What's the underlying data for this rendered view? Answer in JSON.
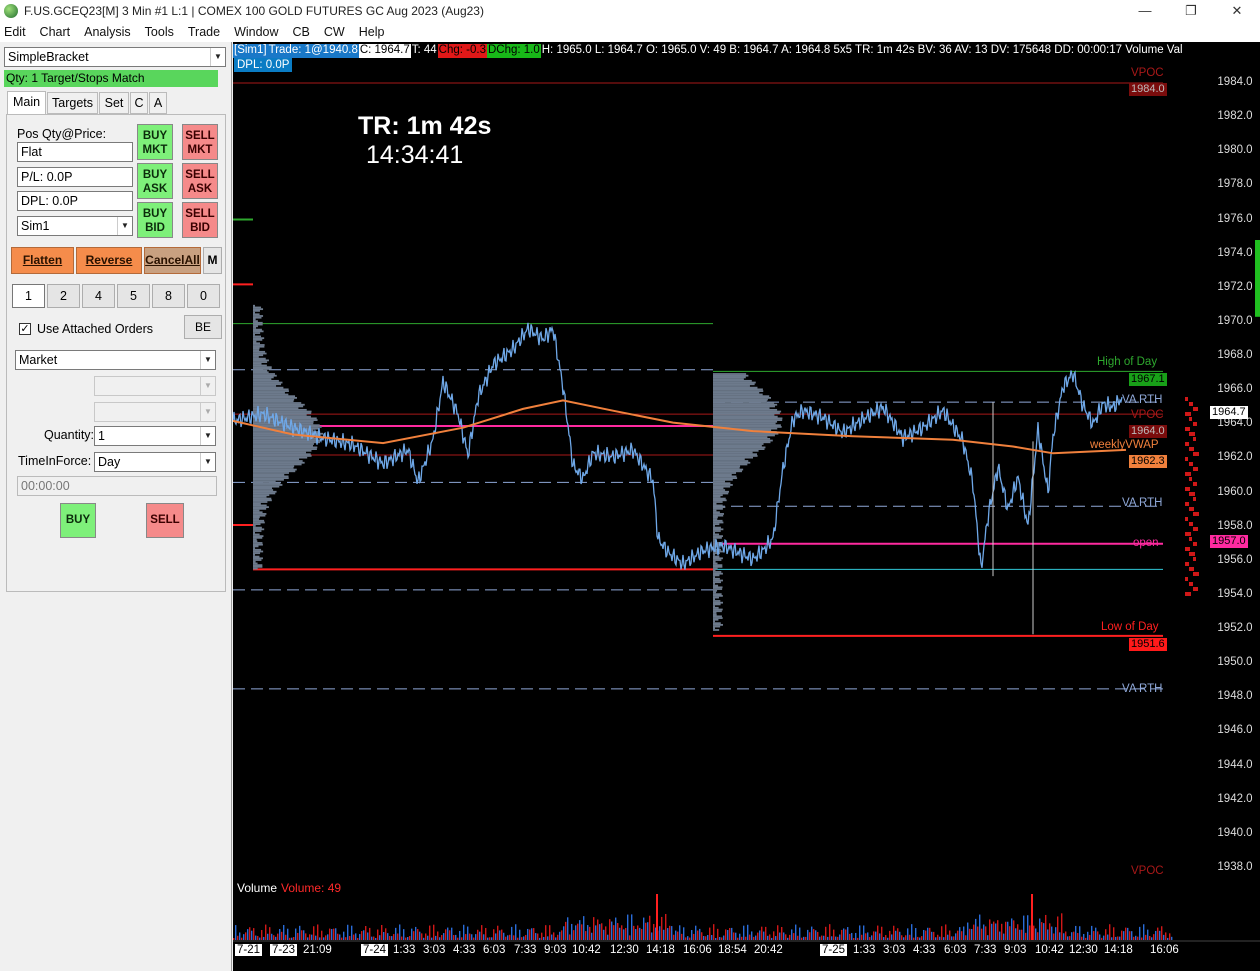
{
  "window": {
    "title": "F.US.GCEQ23[M]  3 Min  #1 L:1 | COMEX 100 GOLD FUTURES GC Aug 2023 (Aug23)",
    "minimize": "—",
    "restore": "❐",
    "close": "✕"
  },
  "menu": [
    "Edit",
    "Chart",
    "Analysis",
    "Tools",
    "Trade",
    "Window",
    "CB",
    "CW",
    "Help"
  ],
  "panel": {
    "strategy": "SimpleBracket",
    "qty_status": "Qty: 1 Target/Stops Match",
    "tabs": [
      "Main",
      "Targets",
      "Set",
      "C",
      "A"
    ],
    "pos_label": "Pos Qty@Price:",
    "pos_value": "Flat",
    "pl": "P/L: 0.0P",
    "dpl": "DPL: 0.0P",
    "account": "Sim1",
    "buy_mkt": "BUY\nMKT",
    "sell_mkt": "SELL\nMKT",
    "buy_ask": "BUY\nASK",
    "sell_ask": "SELL\nASK",
    "buy_bid": "BUY\nBID",
    "sell_bid": "SELL\nBID",
    "flatten": "Flatten",
    "reverse": "Reverse",
    "cancel_all": "CancelAll",
    "m_btn": "M",
    "qty_buttons": [
      "1",
      "2",
      "4",
      "5",
      "8",
      "0"
    ],
    "use_attached": "Use Attached Orders",
    "be": "BE",
    "order_type": "Market",
    "quantity_label": "Quantity:",
    "quantity": "1",
    "tif_label": "TimeInForce:",
    "tif": "Day",
    "time_field": "00:00:00",
    "buy": "BUY",
    "sell": "SELL"
  },
  "chart": {
    "info": [
      {
        "text": "[Sim1]",
        "bg": "#1978c8",
        "fg": "#ffffff"
      },
      {
        "text": "Trade: 1@1940.8",
        "bg": "#1978c8",
        "fg": "#ffffff"
      },
      {
        "text": "C: 1964.7",
        "bg": "#ffffff",
        "fg": "#000000"
      },
      {
        "text": "T: 44",
        "bg": "#000000",
        "fg": "#ffffff"
      },
      {
        "text": "Chg: -0.3",
        "bg": "#e01818",
        "fg": "#000000"
      },
      {
        "text": "DChg: 1.0",
        "bg": "#18b818",
        "fg": "#000000"
      },
      {
        "text": "H: 1965.0 L: 1964.7 O: 1965.0 V: 49 B: 1964.7 A: 1964.8 5x5 TR: 1m 42s BV: 36 AV: 13 DV: 175648 DD: 00:00:17 Volume Val",
        "bg": "#000000",
        "fg": "#ffffff"
      }
    ],
    "dpl": "DPL: 0.0P",
    "tr_big": "TR: 1m 42s",
    "clock": "14:34:41",
    "y_ticks": [
      "1984.0",
      "1982.0",
      "1980.0",
      "1978.0",
      "1976.0",
      "1974.0",
      "1972.0",
      "1970.0",
      "1968.0",
      "1966.0",
      "1964.0",
      "1962.0",
      "1960.0",
      "1958.0",
      "1956.0",
      "1954.0",
      "1952.0",
      "1950.0",
      "1948.0",
      "1946.0",
      "1944.0",
      "1942.0",
      "1940.0",
      "1938.0"
    ],
    "levels": {
      "vpoc_top": "VPOC",
      "vpoc_top_price": "1984.0",
      "high_of_day": "High of Day",
      "high_of_day_price": "1967.1",
      "va_rth_upper": "VA RTH",
      "vpoc_mid": "VPOC",
      "vpoc_mid_price": "1964.0",
      "weekly_vwap": "weeklyVWAP",
      "weekly_vwap_price": "1962.3",
      "va_rth_mid": "VA RTH",
      "open": "open",
      "open_price": "1957.0",
      "low_of_day": "Low of Day",
      "low_of_day_price": "1951.6",
      "va_rth_low": "VA RTH",
      "vpoc_bottom": "VPOC",
      "last_price": "1964.7"
    },
    "volume_label": "Volume",
    "volume_value": "Volume: 49",
    "time_labels": [
      {
        "text": "7-21",
        "box": true
      },
      {
        "text": "7-23",
        "box": true
      },
      {
        "text": "21:09",
        "box": false
      },
      {
        "text": "7-24",
        "box": true
      },
      {
        "text": "1:33",
        "box": false
      },
      {
        "text": "3:03",
        "box": false
      },
      {
        "text": "4:33",
        "box": false
      },
      {
        "text": "6:03",
        "box": false
      },
      {
        "text": "7:33",
        "box": false
      },
      {
        "text": "9:03",
        "box": false
      },
      {
        "text": "10:42",
        "box": false
      },
      {
        "text": "12:30",
        "box": false
      },
      {
        "text": "14:18",
        "box": false
      },
      {
        "text": "16:06",
        "box": false
      },
      {
        "text": "18:54",
        "box": false
      },
      {
        "text": "20:42",
        "box": false
      },
      {
        "text": "7-25",
        "box": true
      },
      {
        "text": "1:33",
        "box": false
      },
      {
        "text": "3:03",
        "box": false
      },
      {
        "text": "4:33",
        "box": false
      },
      {
        "text": "6:03",
        "box": false
      },
      {
        "text": "7:33",
        "box": false
      },
      {
        "text": "9:03",
        "box": false
      },
      {
        "text": "10:42",
        "box": false
      },
      {
        "text": "12:30",
        "box": false
      },
      {
        "text": "14:18",
        "box": false
      },
      {
        "text": "16:06",
        "box": false
      }
    ],
    "colors": {
      "price_line": "#6fa8e8",
      "vwap": "#f0803c",
      "high": "#2ea82e",
      "low": "#ff2020",
      "open": "#ff2aa0",
      "va_rth": "#8fa8d8",
      "vpoc": "#a81818",
      "cyan": "#30c8d8"
    }
  }
}
